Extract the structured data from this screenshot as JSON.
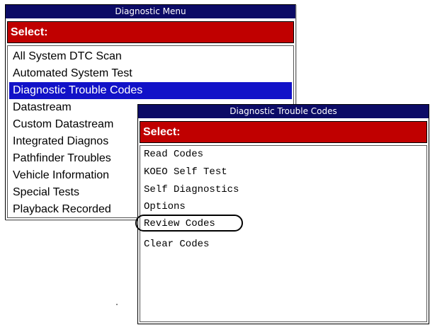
{
  "back_window": {
    "title": "Diagnostic Menu",
    "select_label": "Select:",
    "items": [
      {
        "label": "All System DTC Scan"
      },
      {
        "label": "Automated System Test"
      },
      {
        "label": "Diagnostic Trouble Codes"
      },
      {
        "label": "Datastream"
      },
      {
        "label": "Custom Datastream"
      },
      {
        "label": "Integrated Diagnos"
      },
      {
        "label": "Pathfinder Troubles"
      },
      {
        "label": "Vehicle Information"
      },
      {
        "label": "Special Tests"
      },
      {
        "label": "Playback Recorded"
      }
    ],
    "selected_label": "Diagnostic Trouble Codes"
  },
  "front_window": {
    "title": "Diagnostic Trouble Codes",
    "select_label": "Select:",
    "items": [
      {
        "label": "Read Codes"
      },
      {
        "label": "KOEO Self Test"
      },
      {
        "label": "Self Diagnostics"
      },
      {
        "label": "Options"
      },
      {
        "label": "Review Codes"
      },
      {
        "label": "Clear Codes"
      }
    ],
    "highlighted_label": "Review Codes"
  },
  "colors": {
    "title_bar": "#0c0b66",
    "select_bar": "#c00000",
    "selection": "#1212c8"
  }
}
